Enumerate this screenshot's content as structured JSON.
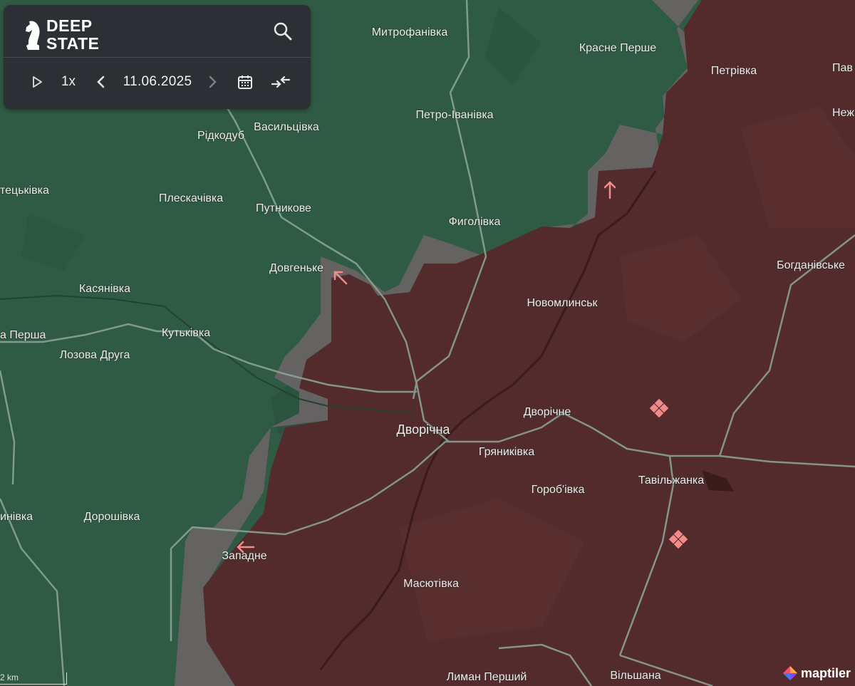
{
  "app": {
    "brand_line1": "DEEP",
    "brand_line2": "STATE",
    "logo_icon": "knight-chess-icon",
    "search_icon": "search-icon"
  },
  "controls": {
    "play_icon": "play-icon",
    "speed_label": "1x",
    "prev_icon": "chevron-left-icon",
    "date_label": "11.06.2025",
    "next_icon": "chevron-right-icon",
    "calendar_icon": "calendar-icon",
    "compare_icon": "compare-arrows-icon"
  },
  "map": {
    "colors": {
      "controlled_area": "#2f5a43",
      "occupied_area": "#542b2c",
      "contested_area": "#6a6466",
      "roads": "#8aa59a",
      "marker": "#f28a8a"
    },
    "places": [
      {
        "name": "Митрофанівка"
      },
      {
        "name": "Красне Перше"
      },
      {
        "name": "Петрівка"
      },
      {
        "name": "Пав"
      },
      {
        "name": "Неж"
      },
      {
        "name": "Петро-Іванівка"
      },
      {
        "name": "Рідкодуб"
      },
      {
        "name": "Васильцівка"
      },
      {
        "name": "тецьківка"
      },
      {
        "name": "Плескачівка"
      },
      {
        "name": "Путникове"
      },
      {
        "name": "Фиголівка"
      },
      {
        "name": "Довгеньке"
      },
      {
        "name": "Касянівка"
      },
      {
        "name": "Новомлинськ"
      },
      {
        "name": "Богданівське"
      },
      {
        "name": "а Перша"
      },
      {
        "name": "Кутьківка"
      },
      {
        "name": "Лозова Друга"
      },
      {
        "name": "Дворічне"
      },
      {
        "name": "Дворічна"
      },
      {
        "name": "Гряниківка"
      },
      {
        "name": "Тавільжанка"
      },
      {
        "name": "Гороб'івка"
      },
      {
        "name": "инівка"
      },
      {
        "name": "Дорошівка"
      },
      {
        "name": "Западне"
      },
      {
        "name": "Масютівка"
      },
      {
        "name": "Лиман Перший"
      },
      {
        "name": "Вільшана"
      }
    ],
    "markers": [
      {
        "type": "arrow-up-icon"
      },
      {
        "type": "arrow-up-left-icon"
      },
      {
        "type": "arrow-left-icon"
      },
      {
        "type": "diamond-cluster-icon"
      },
      {
        "type": "diamond-cluster-icon"
      }
    ]
  },
  "footer": {
    "scale_label": "2 km",
    "attribution": "maptiler"
  }
}
